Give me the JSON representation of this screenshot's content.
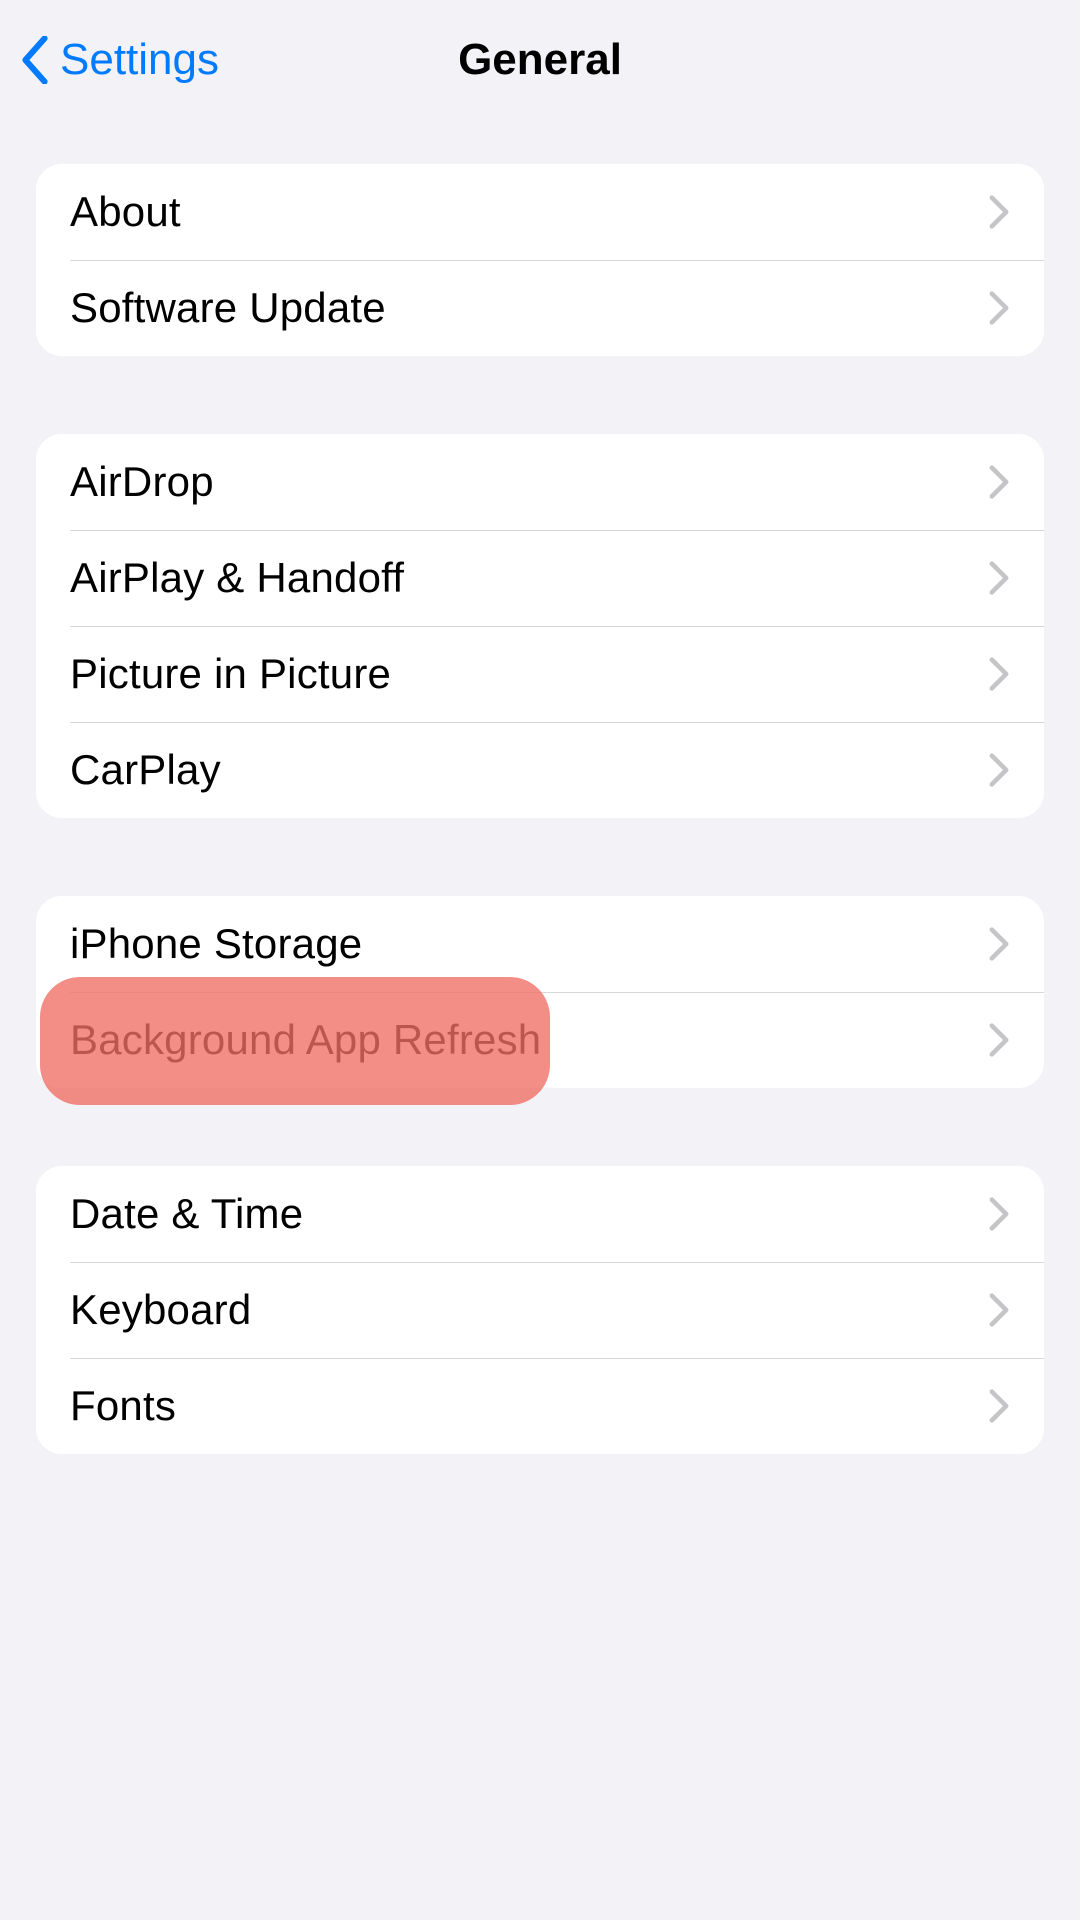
{
  "nav": {
    "back_label": "Settings",
    "title": "General"
  },
  "groups": [
    {
      "id": "info",
      "items": [
        {
          "id": "about",
          "label": "About"
        },
        {
          "id": "software-update",
          "label": "Software Update"
        }
      ]
    },
    {
      "id": "connectivity",
      "items": [
        {
          "id": "airdrop",
          "label": "AirDrop"
        },
        {
          "id": "airplay-handoff",
          "label": "AirPlay & Handoff"
        },
        {
          "id": "picture-in-picture",
          "label": "Picture in Picture"
        },
        {
          "id": "carplay",
          "label": "CarPlay"
        }
      ]
    },
    {
      "id": "storage",
      "items": [
        {
          "id": "iphone-storage",
          "label": "iPhone Storage"
        },
        {
          "id": "background-app-refresh",
          "label": "Background App Refresh",
          "highlighted": true
        }
      ]
    },
    {
      "id": "system",
      "items": [
        {
          "id": "date-time",
          "label": "Date & Time"
        },
        {
          "id": "keyboard",
          "label": "Keyboard"
        },
        {
          "id": "fonts",
          "label": "Fonts"
        }
      ]
    }
  ],
  "annotation": {
    "highlight_color": "#ef7a72"
  }
}
